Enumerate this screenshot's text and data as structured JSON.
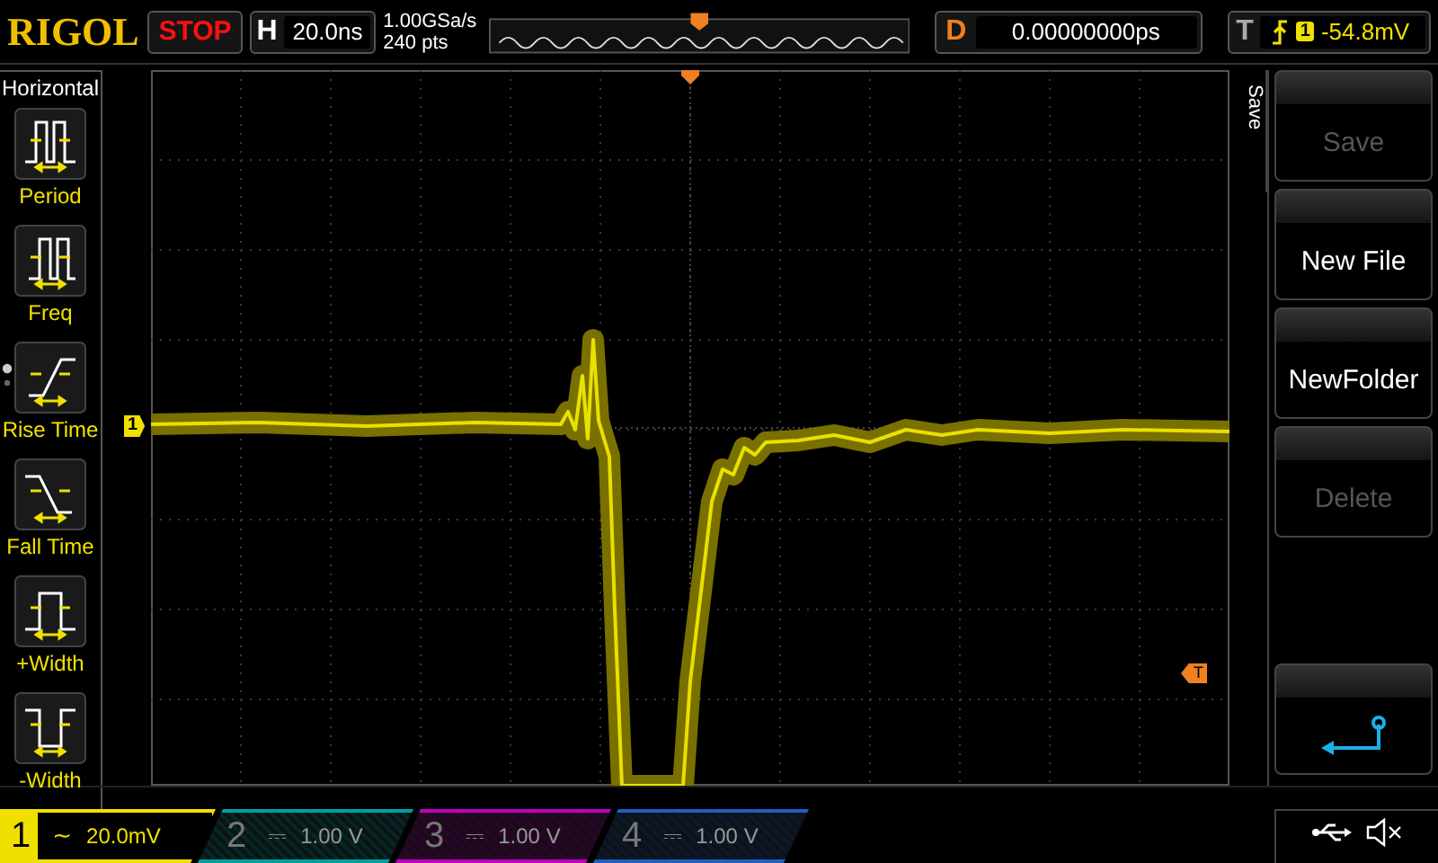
{
  "brand": "RIGOL",
  "run_state": {
    "label": "STOP",
    "kind": "stop"
  },
  "horizontal": {
    "label": "H",
    "value": "20.0ns"
  },
  "sample": {
    "rate": "1.00GSa/s",
    "depth": "240 pts"
  },
  "delay": {
    "label": "D",
    "value": "0.00000000ps"
  },
  "trigger": {
    "label": "T",
    "channel": "1",
    "level": "-54.8mV"
  },
  "left_menu": {
    "title": "Horizontal",
    "items": [
      {
        "label": "Period",
        "kind": "period"
      },
      {
        "label": "Freq",
        "kind": "freq"
      },
      {
        "label": "Rise Time",
        "kind": "rise"
      },
      {
        "label": "Fall Time",
        "kind": "fall"
      },
      {
        "label": "+Width",
        "kind": "pwidth"
      },
      {
        "label": "-Width",
        "kind": "nwidth"
      }
    ]
  },
  "markers": {
    "channel": "1",
    "trigger_level": "T"
  },
  "right_menu": {
    "title": "Save",
    "buttons": [
      {
        "kind": "text",
        "label": "Save",
        "disabled": true
      },
      {
        "kind": "text",
        "label": "New File",
        "disabled": false
      },
      {
        "kind": "text",
        "label": "NewFolder",
        "disabled": false
      },
      {
        "kind": "text",
        "label": "Delete",
        "disabled": true
      },
      {
        "kind": "spacer"
      },
      {
        "kind": "back"
      }
    ]
  },
  "channels": [
    {
      "number": "1",
      "coupling": "~",
      "scale": "20.0mV",
      "on": true,
      "color": "#f0e000"
    },
    {
      "number": "2",
      "coupling": "⎓",
      "scale": "1.00 V",
      "on": false,
      "color": "#00a0a0"
    },
    {
      "number": "3",
      "coupling": "⎓",
      "scale": "1.00 V",
      "on": false,
      "color": "#c000c0"
    },
    {
      "number": "4",
      "coupling": "⎓",
      "scale": "1.00 V",
      "on": false,
      "color": "#2060c0"
    }
  ]
}
